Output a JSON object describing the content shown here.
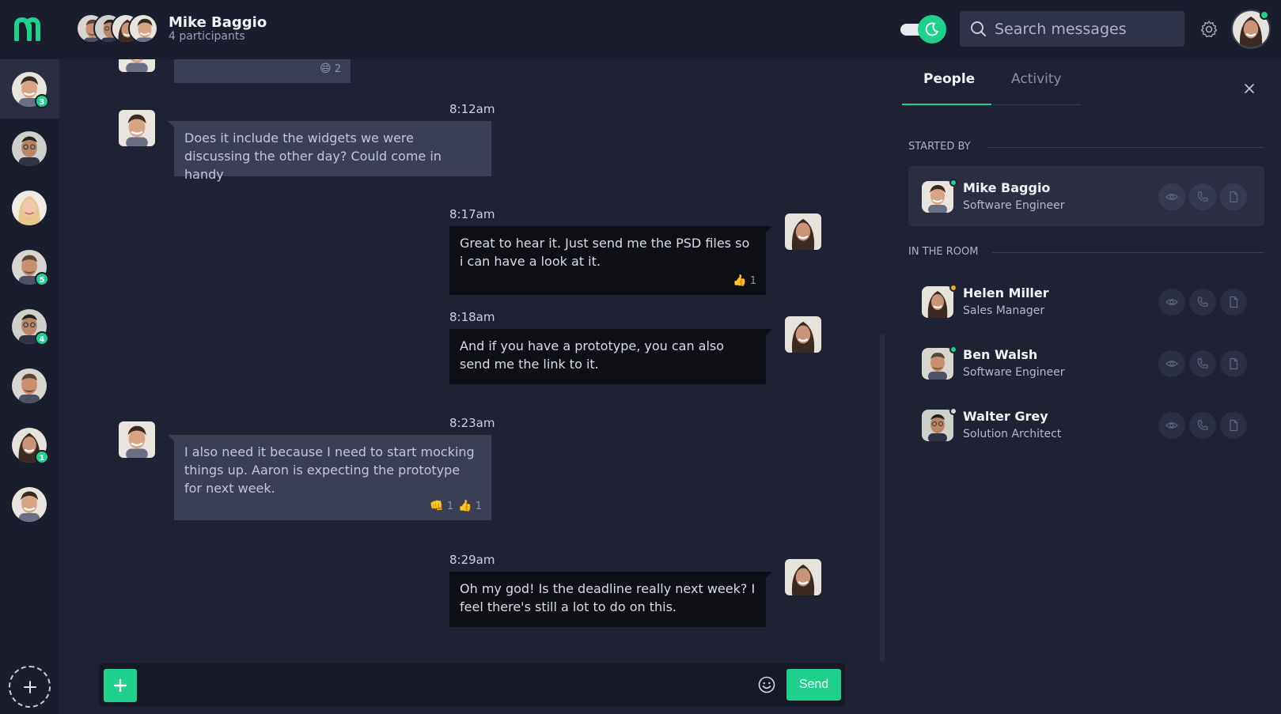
{
  "header": {
    "title": "Mike Baggio",
    "subtitle": "4 participants",
    "search_placeholder": "Search messages"
  },
  "rail": {
    "conversations": [
      {
        "badge": "3",
        "active": true
      },
      {
        "badge": ""
      },
      {
        "badge": ""
      },
      {
        "badge": "5"
      },
      {
        "badge": "4"
      },
      {
        "badge": ""
      },
      {
        "badge": "1"
      },
      {
        "badge": ""
      }
    ]
  },
  "messages": [
    {
      "id": "m0",
      "direction": "in",
      "text": "",
      "reactions": [
        {
          "emoji": "😄",
          "count": "2"
        }
      ]
    },
    {
      "id": "m1",
      "direction": "in",
      "time": "8:12am",
      "text": "Does it include the widgets we were discussing the other day? Could come in handy"
    },
    {
      "id": "m2",
      "direction": "out",
      "time": "8:17am",
      "text": "Great to hear it. Just send me the PSD files so i can have a look at it.",
      "reactions": [
        {
          "emoji": "👍",
          "count": "1"
        }
      ]
    },
    {
      "id": "m3",
      "direction": "out",
      "time": "8:18am",
      "text": "And if you have a prototype, you can also send me the link to it."
    },
    {
      "id": "m4",
      "direction": "in",
      "time": "8:23am",
      "text": "I also need it because I need to start mocking things up. Aaron is expecting the prototype for next week.",
      "reactions": [
        {
          "emoji": "👊",
          "count": "1"
        },
        {
          "emoji": "👍",
          "count": "1"
        }
      ]
    },
    {
      "id": "m5",
      "direction": "out",
      "time": "8:29am",
      "text": "Oh my god! Is the deadline really next week? I feel there's still a lot to do on this."
    }
  ],
  "composer": {
    "placeholder": "",
    "send_label": "Send"
  },
  "panel": {
    "tabs": [
      {
        "label": "People",
        "active": true
      },
      {
        "label": "Activity",
        "active": false
      }
    ],
    "started_by_label": "STARTED BY",
    "in_room_label": "IN THE ROOM",
    "started_by": {
      "name": "Mike Baggio",
      "role": "Software Engineer",
      "status_color": "#1fd18d"
    },
    "in_room": [
      {
        "name": "Helen Miller",
        "role": "Sales Manager",
        "status_color": "#f5a623"
      },
      {
        "name": "Ben Walsh",
        "role": "Software Engineer",
        "status_color": "#1fd18d"
      },
      {
        "name": "Walter Grey",
        "role": "Solution Architect",
        "status_color": "#d7d9e3"
      }
    ]
  },
  "colors": {
    "accent": "#1fd18d",
    "background": "#1f2232",
    "sidebar": "#1a1d2c",
    "incoming_bubble": "#3a3f56",
    "outgoing_bubble": "#0f1016"
  },
  "icons": {
    "logo": "m-logo-icon",
    "theme_toggle": "moon-icon",
    "search": "search-icon",
    "settings": "gear-icon",
    "add": "plus-icon",
    "emoji": "smile-icon",
    "close": "close-icon",
    "view": "eye-icon",
    "call": "phone-icon",
    "file": "file-icon"
  }
}
